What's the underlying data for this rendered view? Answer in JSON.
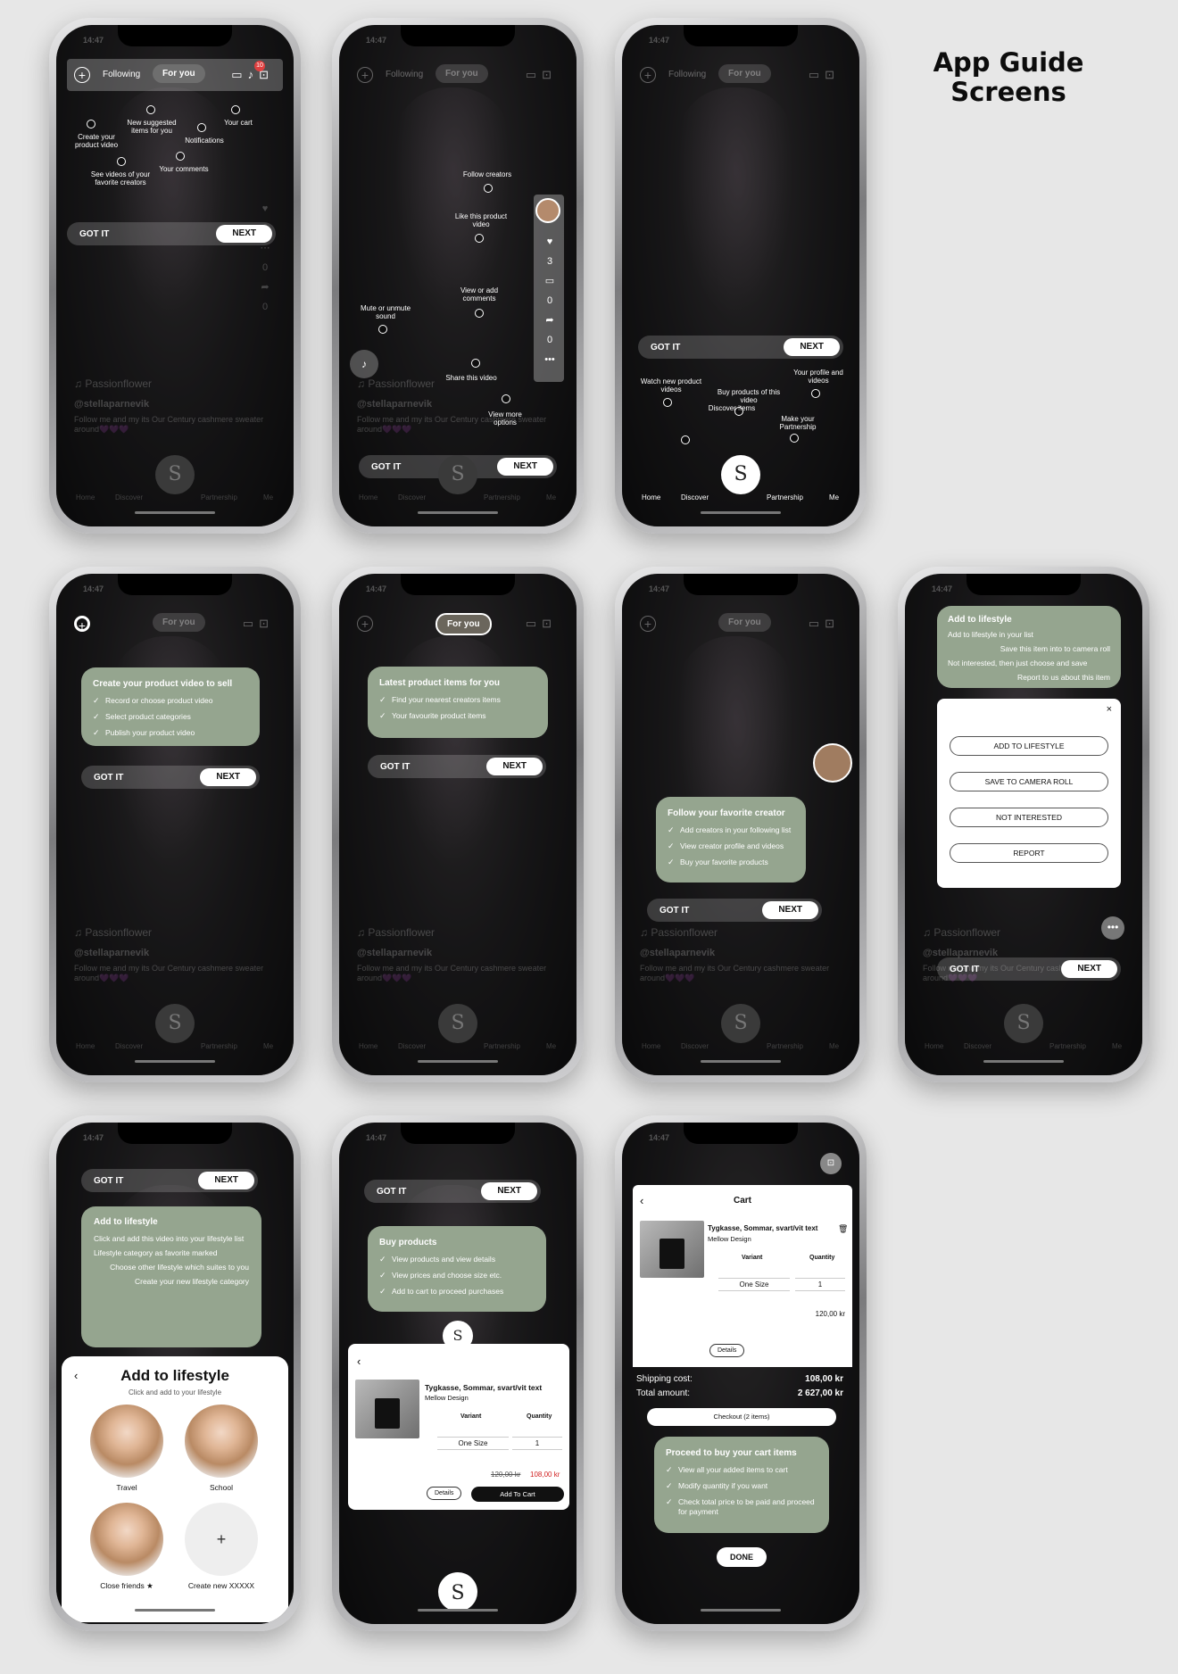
{
  "page_title_line1": "App Guide",
  "page_title_line2": "Screens",
  "status_time": "14:47",
  "common": {
    "got_it": "GOT IT",
    "next": "NEXT",
    "done": "DONE",
    "following": "Following",
    "for_you": "For you",
    "song": "♫ Passionflower",
    "username": "@stellaparnevik",
    "caption": "Follow me and my its Our Century cashmere sweater around💜💜💜",
    "nav_home": "Home",
    "nav_discover": "Discover",
    "nav_partnership": "Partnership",
    "nav_me": "Me",
    "badge": "10",
    "rail_counts": [
      "3",
      "0",
      "0"
    ]
  },
  "screen1": {
    "create": "Create your product video",
    "see": "See videos of your favorite creators",
    "suggested": "New suggested items for you",
    "comments": "Your comments",
    "notifications": "Notifications",
    "cart": "Your cart"
  },
  "screen2": {
    "follow": "Follow creators",
    "like": "Like this product video",
    "comments": "View or add comments",
    "mute": "Mute or unmute sound",
    "share": "Share this video",
    "more": "View more options"
  },
  "screen3": {
    "watch": "Watch new product videos",
    "discover": "Discover items",
    "buy": "Buy products of this video",
    "partnership": "Make your Partnership",
    "profile": "Your profile and videos"
  },
  "screen4": {
    "title": "Create your product video to sell",
    "items": [
      "Record or choose product video",
      "Select product categories",
      "Publish your product video"
    ]
  },
  "screen5": {
    "title": "Latest product items for you",
    "items": [
      "Find your nearest creators items",
      "Your favourite product items"
    ]
  },
  "screen6": {
    "title": "Follow your favorite creator",
    "items": [
      "Add creators in your following list",
      "View creator profile and videos",
      "Buy your favorite products"
    ]
  },
  "screen7": {
    "title": "Add to lifestyle",
    "lines": [
      "Add to lifestyle in your list",
      "Save this item into to camera roll",
      "Not interested, then just choose and save",
      "Report to us about this item"
    ],
    "buttons": [
      "ADD TO LIFESTYLE",
      "SAVE TO CAMERA ROLL",
      "NOT INTERESTED",
      "REPORT"
    ]
  },
  "screen8": {
    "card_title": "Add to lifestyle",
    "lines": [
      "Click and add this video into your lifestyle list",
      "Lifestyle category as favorite marked",
      "Choose other lifestyle which suites to you",
      "Create your new lifestyle category"
    ],
    "sheet_title": "Add to lifestyle",
    "sheet_sub": "Click and add to your lifestyle",
    "cats": [
      "Travel",
      "School",
      "Close friends ★",
      "Create new XXXXX"
    ]
  },
  "screen9": {
    "title": "Buy products",
    "items": [
      "View products and view details",
      "View prices and choose size etc.",
      "Add to cart to proceed purchases"
    ],
    "product_name": "Tygkasse, Sommar, svart/vit text",
    "brand": "Mellow Design",
    "variant_h": "Variant",
    "quantity_h": "Quantity",
    "variant": "One Size",
    "quantity": "1",
    "old_price": "120,00 kr",
    "new_price": "108,00 kr",
    "details": "Details",
    "add_to_cart": "Add To Cart"
  },
  "screen10": {
    "cart_title": "Cart",
    "product_name": "Tygkasse, Sommar, svart/vit text",
    "brand": "Mellow Design",
    "variant_h": "Variant",
    "quantity_h": "Quantity",
    "variant": "One Size",
    "quantity": "1",
    "price": "120,00 kr",
    "details": "Details",
    "shipping_label": "Shipping cost:",
    "shipping_value": "108,00 kr",
    "total_label": "Total amount:",
    "total_value": "2 627,00 kr",
    "checkout": "Checkout (2 items)",
    "card_title": "Proceed to buy your cart items",
    "items": [
      "View all your added items to cart",
      "Modify quantity if you want",
      "Check total price to be paid and proceed for payment"
    ]
  }
}
